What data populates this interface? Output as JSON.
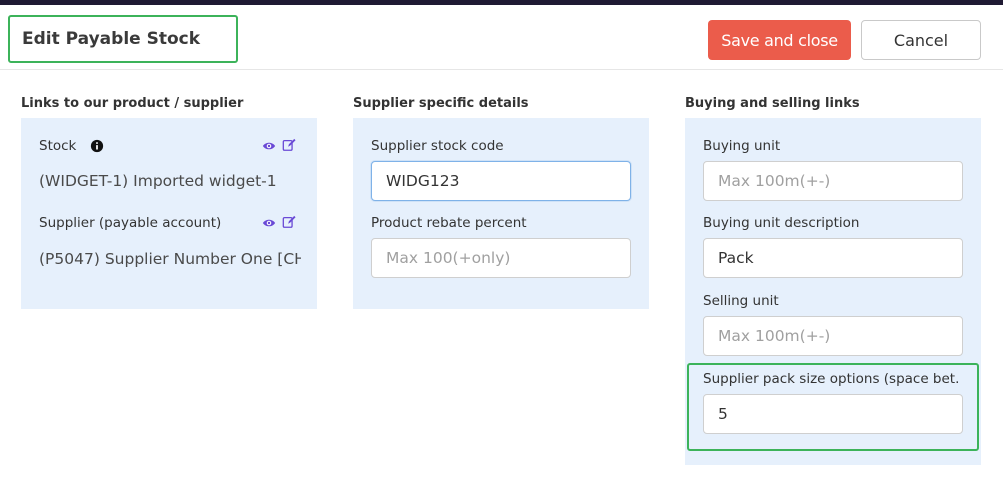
{
  "header": {
    "title": "Edit Payable Stock",
    "save_label": "Save and close",
    "cancel_label": "Cancel"
  },
  "columns": {
    "links": {
      "heading": "Links to our product / supplier",
      "stock_label": "Stock",
      "stock_value": "(WIDGET-1) Imported widget-1",
      "supplier_label": "Supplier (payable account)",
      "supplier_value": "(P5047) Supplier Number One [CH"
    },
    "supplier_details": {
      "heading": "Supplier specific details",
      "stock_code_label": "Supplier stock code",
      "stock_code_value": "WIDG123",
      "rebate_label": "Product rebate percent",
      "rebate_placeholder": "Max 100(+only)"
    },
    "buying_selling": {
      "heading": "Buying and selling links",
      "buying_unit_label": "Buying unit",
      "buying_unit_placeholder": "Max 100m(+-)",
      "buying_desc_label": "Buying unit description",
      "buying_desc_value": "Pack",
      "selling_unit_label": "Selling unit",
      "selling_unit_placeholder": "Max 100m(+-)",
      "pack_size_label": "Supplier pack size options (space bet...",
      "pack_size_value": "5"
    }
  },
  "icons": {
    "info": "info-circle-icon",
    "view": "eye-icon",
    "edit": "edit-icon"
  },
  "colors": {
    "accent_save": "#eb5c4b",
    "panel_bg": "#e6f0fc",
    "highlight": "#3cb35a",
    "icon_purple": "#6a4ad6"
  }
}
